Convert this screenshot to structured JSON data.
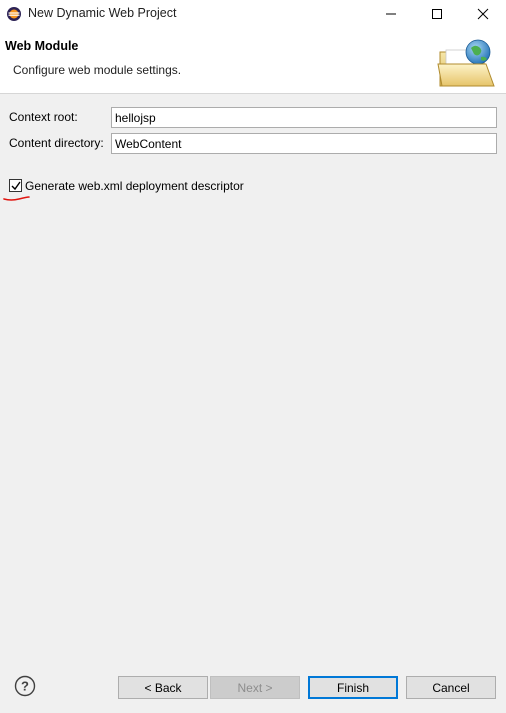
{
  "window": {
    "title": "New Dynamic Web Project"
  },
  "header": {
    "title": "Web Module",
    "description": "Configure web module settings."
  },
  "form": {
    "context_root": {
      "label": "Context root:",
      "value": "hellojsp"
    },
    "content_directory": {
      "label": "Content directory:",
      "value": "WebContent"
    },
    "generate_descriptor": {
      "label": "Generate web.xml deployment descriptor",
      "checked": true
    }
  },
  "buttons": {
    "back": "< Back",
    "next": "Next >",
    "finish": "Finish",
    "cancel": "Cancel"
  },
  "icons": {
    "app": "eclipse-icon",
    "banner": "folder-globe-icon",
    "help": "help-icon"
  },
  "colors": {
    "focus_border": "#0078d7",
    "annotation": "#e0140f"
  }
}
